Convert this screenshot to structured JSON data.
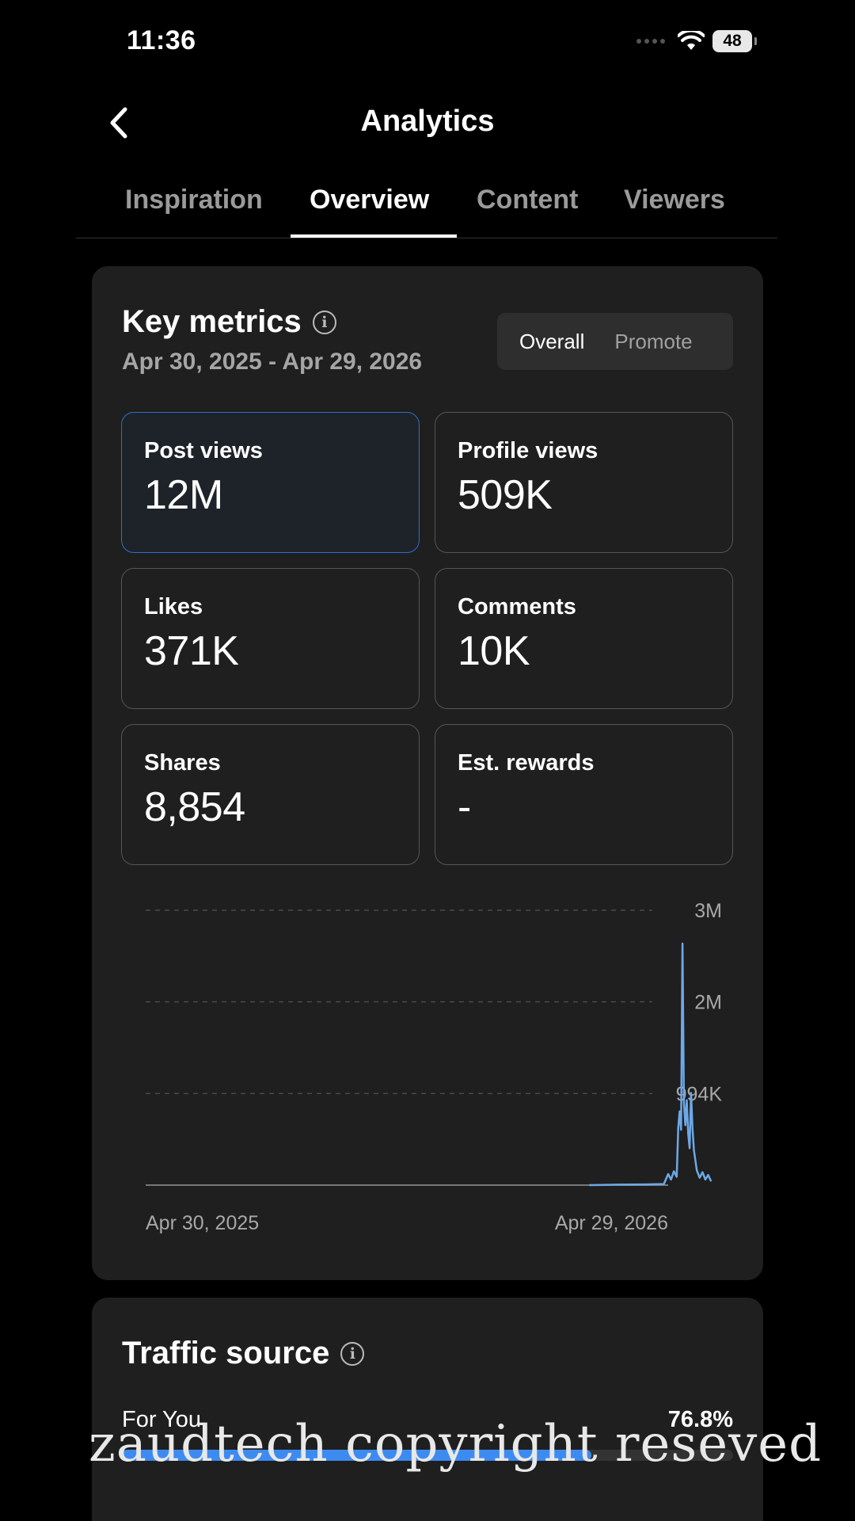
{
  "status": {
    "time": "11:36",
    "battery": "48"
  },
  "header": {
    "title": "Analytics"
  },
  "tabs": [
    {
      "label": "Inspiration",
      "active": false
    },
    {
      "label": "Overview",
      "active": true
    },
    {
      "label": "Content",
      "active": false
    },
    {
      "label": "Viewers",
      "active": false
    }
  ],
  "key_metrics": {
    "title": "Key metrics",
    "date_range": "Apr 30, 2025 - Apr 29, 2026",
    "segments": [
      "Overall",
      "Promote"
    ],
    "selected_segment": "Overall",
    "tiles": [
      {
        "label": "Post views",
        "value": "12M",
        "selected": true
      },
      {
        "label": "Profile views",
        "value": "509K",
        "selected": false
      },
      {
        "label": "Likes",
        "value": "371K",
        "selected": false
      },
      {
        "label": "Comments",
        "value": "10K",
        "selected": false
      },
      {
        "label": "Shares",
        "value": "8,854",
        "selected": false
      },
      {
        "label": "Est. rewards",
        "value": "-",
        "selected": false
      }
    ]
  },
  "chart_data": {
    "type": "line",
    "series_color": "#6ea8e6",
    "y_ticks": [
      {
        "label": "3M",
        "value": 2982000
      },
      {
        "label": "2M",
        "value": 1988000
      },
      {
        "label": "994K",
        "value": 994000
      }
    ],
    "ylim": [
      0,
      2982000
    ],
    "x_labels": [
      "Apr 30, 2025",
      "Apr 29, 2026"
    ],
    "grid": true,
    "values_note_days": 365,
    "points": [
      [
        0,
        0
      ],
      [
        310,
        0
      ],
      [
        330,
        5000
      ],
      [
        350,
        8000
      ],
      [
        362,
        12000
      ],
      [
        365,
        120000
      ],
      [
        367,
        60000
      ],
      [
        369,
        150000
      ],
      [
        371,
        90000
      ],
      [
        372,
        620000
      ],
      [
        373,
        800000
      ],
      [
        374,
        600000
      ],
      [
        375,
        2620000
      ],
      [
        376,
        900000
      ],
      [
        377,
        650000
      ],
      [
        378,
        920000
      ],
      [
        379,
        560000
      ],
      [
        380,
        400000
      ],
      [
        381,
        1000000
      ],
      [
        382,
        620000
      ],
      [
        383,
        380000
      ],
      [
        385,
        160000
      ],
      [
        387,
        80000
      ],
      [
        389,
        140000
      ],
      [
        391,
        60000
      ],
      [
        393,
        110000
      ],
      [
        395,
        40000
      ]
    ]
  },
  "traffic_source": {
    "title": "Traffic source",
    "items": [
      {
        "label": "For You",
        "percent": "76.8%",
        "fraction": 0.768
      }
    ]
  },
  "watermark": "zaudtech copyright reseved"
}
